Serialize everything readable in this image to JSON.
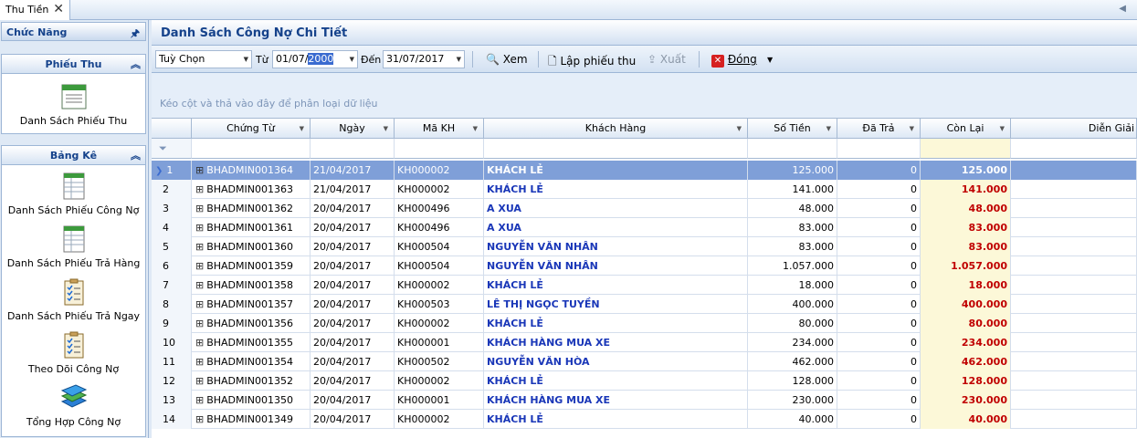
{
  "doc_tab": {
    "label": "Thu Tiền",
    "close": "✕"
  },
  "left_panel": {
    "title": "Chức Năng",
    "groups": [
      {
        "title": "Phiếu Thu",
        "items": [
          {
            "label": "Danh Sách Phiếu Thu",
            "icon": "form-sheet-icon"
          }
        ]
      },
      {
        "title": "Bảng Kê",
        "items": [
          {
            "label": "Danh Sách Phiếu Công Nợ",
            "icon": "spreadsheet-icon"
          },
          {
            "label": "Danh Sách Phiếu Trả Hàng",
            "icon": "spreadsheet-icon"
          },
          {
            "label": "Danh Sách Phiếu Trả Ngay",
            "icon": "checklist-clipboard-icon"
          },
          {
            "label": "Theo Dõi Công Nợ",
            "icon": "checklist-clipboard-icon"
          },
          {
            "label": "Tổng Hợp Công Nợ",
            "icon": "books-stack-icon"
          }
        ]
      }
    ]
  },
  "main": {
    "title": "Danh Sách Công Nợ Chi Tiết",
    "toolbar": {
      "period": "Tuỳ Chọn",
      "from_label": "Từ",
      "from_value_prefix": "01/07/",
      "from_value_selected": "2000",
      "to_label": "Đến",
      "to_value": "31/07/2017",
      "view_label": "Xem",
      "create_label": "Lập phiếu thu",
      "export_label": "Xuất",
      "close_label": "Đóng"
    },
    "group_hint": "Kéo cột và thả vào đây để phân loại dữ liệu",
    "columns": [
      "Chứng Từ",
      "Ngày",
      "Mã KH",
      "Khách Hàng",
      "Số Tiền",
      "Đã Trả",
      "Còn Lại",
      "Diễn Giải"
    ],
    "rows": [
      {
        "n": "1",
        "ct": "BHADMIN001364",
        "ngay": "21/04/2017",
        "makh": "KH000002",
        "kh": "KHÁCH LẺ",
        "sotien": "125.000",
        "datra": "0",
        "conlai": "125.000"
      },
      {
        "n": "2",
        "ct": "BHADMIN001363",
        "ngay": "21/04/2017",
        "makh": "KH000002",
        "kh": "KHÁCH LẺ",
        "sotien": "141.000",
        "datra": "0",
        "conlai": "141.000"
      },
      {
        "n": "3",
        "ct": "BHADMIN001362",
        "ngay": "20/04/2017",
        "makh": "KH000496",
        "kh": "A XUA",
        "sotien": "48.000",
        "datra": "0",
        "conlai": "48.000"
      },
      {
        "n": "4",
        "ct": "BHADMIN001361",
        "ngay": "20/04/2017",
        "makh": "KH000496",
        "kh": "A XUA",
        "sotien": "83.000",
        "datra": "0",
        "conlai": "83.000"
      },
      {
        "n": "5",
        "ct": "BHADMIN001360",
        "ngay": "20/04/2017",
        "makh": "KH000504",
        "kh": "NGUYỄN VĂN NHÂN",
        "sotien": "83.000",
        "datra": "0",
        "conlai": "83.000"
      },
      {
        "n": "6",
        "ct": "BHADMIN001359",
        "ngay": "20/04/2017",
        "makh": "KH000504",
        "kh": "NGUYỄN VĂN NHÂN",
        "sotien": "1.057.000",
        "datra": "0",
        "conlai": "1.057.000"
      },
      {
        "n": "7",
        "ct": "BHADMIN001358",
        "ngay": "20/04/2017",
        "makh": "KH000002",
        "kh": "KHÁCH LẺ",
        "sotien": "18.000",
        "datra": "0",
        "conlai": "18.000"
      },
      {
        "n": "8",
        "ct": "BHADMIN001357",
        "ngay": "20/04/2017",
        "makh": "KH000503",
        "kh": "LÊ THỊ NGỌC TUYỀN",
        "sotien": "400.000",
        "datra": "0",
        "conlai": "400.000"
      },
      {
        "n": "9",
        "ct": "BHADMIN001356",
        "ngay": "20/04/2017",
        "makh": "KH000002",
        "kh": "KHÁCH LẺ",
        "sotien": "80.000",
        "datra": "0",
        "conlai": "80.000"
      },
      {
        "n": "10",
        "ct": "BHADMIN001355",
        "ngay": "20/04/2017",
        "makh": "KH000001",
        "kh": "KHÁCH HÀNG MUA XE",
        "sotien": "234.000",
        "datra": "0",
        "conlai": "234.000"
      },
      {
        "n": "11",
        "ct": "BHADMIN001354",
        "ngay": "20/04/2017",
        "makh": "KH000502",
        "kh": "NGUYỄN VĂN HÒA",
        "sotien": "462.000",
        "datra": "0",
        "conlai": "462.000"
      },
      {
        "n": "12",
        "ct": "BHADMIN001352",
        "ngay": "20/04/2017",
        "makh": "KH000002",
        "kh": "KHÁCH LẺ",
        "sotien": "128.000",
        "datra": "0",
        "conlai": "128.000"
      },
      {
        "n": "13",
        "ct": "BHADMIN001350",
        "ngay": "20/04/2017",
        "makh": "KH000001",
        "kh": "KHÁCH HÀNG MUA XE",
        "sotien": "230.000",
        "datra": "0",
        "conlai": "230.000"
      },
      {
        "n": "14",
        "ct": "BHADMIN001349",
        "ngay": "20/04/2017",
        "makh": "KH000002",
        "kh": "KHÁCH LẺ",
        "sotien": "40.000",
        "datra": "0",
        "conlai": "40.000"
      }
    ],
    "selected_row": 0
  },
  "colors": {
    "header_text": "#15428b",
    "customer_text": "#1a37b8",
    "balance_text": "#c00000",
    "selected_row": "#7f9fd8"
  }
}
